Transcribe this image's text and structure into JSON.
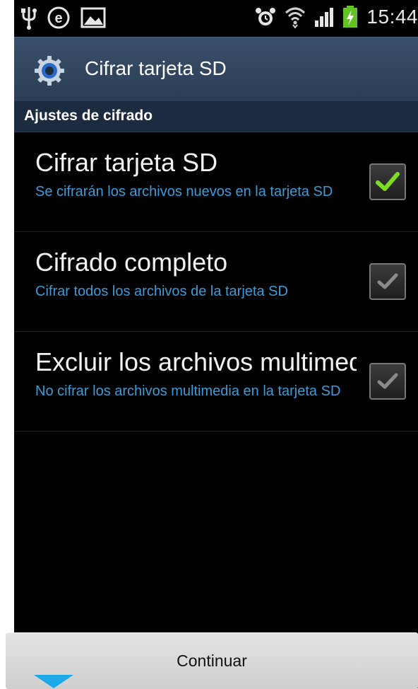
{
  "status_bar": {
    "icons_left": [
      "usb-icon",
      "e-notification-icon",
      "gallery-icon"
    ],
    "icons_right": [
      "alarm-icon",
      "wifi-icon",
      "signal-icon",
      "battery-charging-icon"
    ],
    "time": "15:44"
  },
  "action_bar": {
    "icon": "settings-gear-icon",
    "title": "Cifrar tarjeta SD"
  },
  "section": {
    "header": "Ajustes de cifrado"
  },
  "preferences": [
    {
      "title": "Cifrar tarjeta SD",
      "summary": "Se cifrarán los archivos nuevos en la tarjeta SD",
      "checked": true,
      "enabled": true
    },
    {
      "title": "Cifrado completo",
      "summary": "Cifrar todos los archivos de la tarjeta SD",
      "checked": true,
      "enabled": false
    },
    {
      "title": "Excluir los archivos multimedia",
      "summary": "No cifrar los archivos multimedia en la tarjeta SD",
      "checked": true,
      "enabled": false
    }
  ],
  "continue_button": {
    "label": "Continuar"
  },
  "colors": {
    "action_bar": "#34475f",
    "section_header": "#1c2b3f",
    "summary_text": "#3d9bd8",
    "check_active": "#7ddc1f",
    "check_disabled": "#8a8a8a",
    "handle": "#1ea8e7"
  }
}
